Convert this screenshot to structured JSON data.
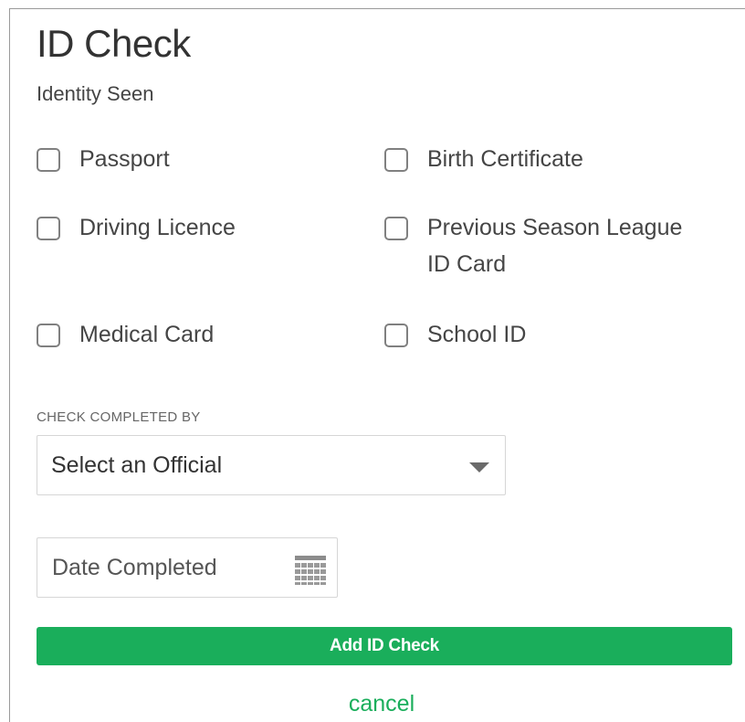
{
  "dialog": {
    "title": "ID Check",
    "subtitle": "Identity Seen"
  },
  "id_types": [
    {
      "label": "Passport",
      "checked": false
    },
    {
      "label": "Birth Certificate",
      "checked": false
    },
    {
      "label": "Driving Licence",
      "checked": false
    },
    {
      "label": "Previous Season League ID Card",
      "checked": false
    },
    {
      "label": "Medical Card",
      "checked": false
    },
    {
      "label": "School ID",
      "checked": false
    }
  ],
  "check_completed_by": {
    "label": "CHECK COMPLETED BY",
    "selected": "Select an Official"
  },
  "date_completed": {
    "placeholder": "Date Completed",
    "value": "",
    "icon": "calendar-icon"
  },
  "actions": {
    "add_label": "Add ID Check",
    "cancel_label": "cancel"
  },
  "colors": {
    "accent": "#1aae5b",
    "checkbox_border": "#808080"
  }
}
